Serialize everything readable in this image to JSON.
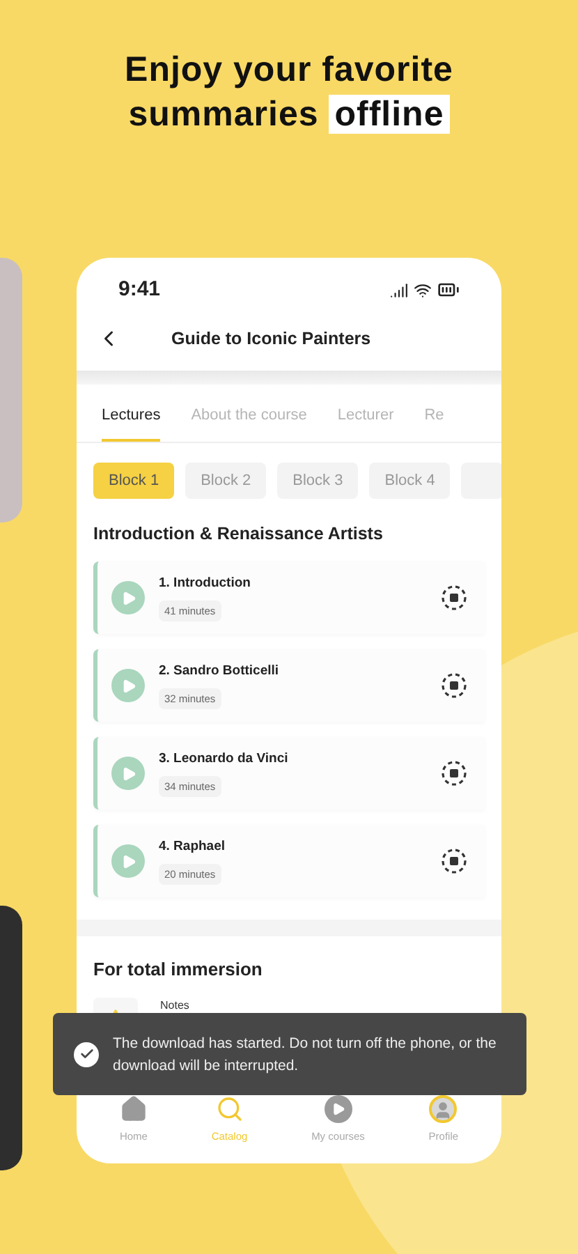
{
  "headline": {
    "lines": [
      "Enjoy your favorite",
      "summaries"
    ],
    "highlight": "offline"
  },
  "status_bar": {
    "time": "9:41"
  },
  "header": {
    "title": "Guide to Iconic Painters"
  },
  "tabs": [
    {
      "label": "Lectures",
      "selected": true
    },
    {
      "label": "About the course",
      "selected": false
    },
    {
      "label": "Lecturer",
      "selected": false
    },
    {
      "label": "Re",
      "selected": false
    }
  ],
  "blocks": [
    {
      "label": "Block 1",
      "selected": true
    },
    {
      "label": "Block 2",
      "selected": false
    },
    {
      "label": "Block 3",
      "selected": false
    },
    {
      "label": "Block 4",
      "selected": false
    }
  ],
  "section_title": "Introduction & Renaissance Artists",
  "lessons": [
    {
      "title": "1. Introduction",
      "duration": "41 minutes"
    },
    {
      "title": "2. Sandro Botticelli",
      "duration": "32 minutes"
    },
    {
      "title": "3. Leonardo da Vinci",
      "duration": "34 minutes"
    },
    {
      "title": "4. Raphael",
      "duration": "20 minutes"
    }
  ],
  "extras": {
    "title": "For total immersion",
    "items": [
      {
        "label": "Notes"
      }
    ]
  },
  "toast": {
    "message": "The download has started. Do not turn off the phone, or the download will be interrupted."
  },
  "nav": [
    {
      "label": "Home",
      "kind": "home",
      "selected": false
    },
    {
      "label": "Catalog",
      "kind": "search",
      "selected": true
    },
    {
      "label": "My courses",
      "kind": "play",
      "selected": false
    },
    {
      "label": "Profile",
      "kind": "profile",
      "selected": false
    }
  ]
}
